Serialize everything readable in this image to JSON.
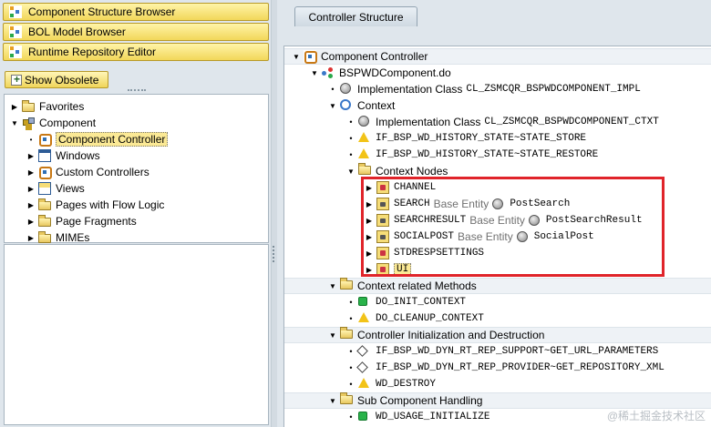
{
  "left_panel": {
    "browsers": [
      {
        "label": "Component Structure Browser",
        "icon": "structure-icon"
      },
      {
        "label": "BOL Model Browser",
        "icon": "structure-icon"
      },
      {
        "label": "Runtime Repository Editor",
        "icon": "structure-icon"
      }
    ],
    "show_obsolete_label": "Show Obsolete",
    "tree": [
      {
        "label": "Favorites",
        "icon": "folder-icon",
        "expander": "collapsed",
        "selected": false
      },
      {
        "label": "Component",
        "icon": "component-icon",
        "expander": "expanded",
        "selected": false
      },
      {
        "label": "Component Controller",
        "icon": "controller-icon",
        "expander": "none",
        "selected": true
      },
      {
        "label": "Windows",
        "icon": "window-icon",
        "expander": "collapsed",
        "selected": false
      },
      {
        "label": "Custom Controllers",
        "icon": "controller-icon",
        "expander": "collapsed",
        "selected": false
      },
      {
        "label": "Views",
        "icon": "view-icon",
        "expander": "collapsed",
        "selected": false
      },
      {
        "label": "Pages with Flow Logic",
        "icon": "folder-icon",
        "expander": "collapsed",
        "selected": false
      },
      {
        "label": "Page Fragments",
        "icon": "folder-icon",
        "expander": "collapsed",
        "selected": false
      },
      {
        "label": "MIMEs",
        "icon": "folder-icon",
        "expander": "collapsed",
        "selected": false
      }
    ]
  },
  "right_panel": {
    "tab_label": "Controller Structure",
    "rows": [
      {
        "text": "Component Controller",
        "extra": "",
        "ref": "",
        "icon": "component-controller-icon",
        "expander": "expanded",
        "mono": false,
        "header": true,
        "selected": false
      },
      {
        "text": "BSPWDComponent.do",
        "extra": "",
        "ref": "",
        "icon": "bsp-component-icon",
        "expander": "expanded",
        "mono": false,
        "header": false,
        "selected": false
      },
      {
        "text": "Implementation Class",
        "extra": "",
        "ref": "CL_ZSMCQR_BSPWDCOMPONENT_IMPL",
        "icon": "class-icon",
        "expander": "bullet",
        "mono": false,
        "header": false,
        "selected": false
      },
      {
        "text": "Context",
        "extra": "",
        "ref": "",
        "icon": "context-icon",
        "expander": "expanded",
        "mono": false,
        "header": false,
        "selected": false
      },
      {
        "text": "Implementation Class",
        "extra": "",
        "ref": "CL_ZSMCQR_BSPWDCOMPONENT_CTXT",
        "icon": "class-icon",
        "expander": "bullet",
        "mono": false,
        "header": false,
        "selected": false
      },
      {
        "text": "IF_BSP_WD_HISTORY_STATE~STATE_STORE",
        "extra": "",
        "ref": "",
        "icon": "warning-icon",
        "expander": "bullet",
        "mono": true,
        "header": false,
        "selected": false
      },
      {
        "text": "IF_BSP_WD_HISTORY_STATE~STATE_RESTORE",
        "extra": "",
        "ref": "",
        "icon": "warning-icon",
        "expander": "bullet",
        "mono": true,
        "header": false,
        "selected": false
      },
      {
        "text": "Context Nodes",
        "extra": "",
        "ref": "",
        "icon": "folder-icon",
        "expander": "expanded",
        "mono": false,
        "header": false,
        "selected": false
      },
      {
        "text": "CHANNEL",
        "extra": "",
        "ref": "",
        "icon": "context-node-icon",
        "expander": "collapsed",
        "mono": true,
        "header": false,
        "selected": false
      },
      {
        "text": "SEARCH",
        "extra": "Base Entity",
        "ref": "PostSearch",
        "icon": "locked-node-icon",
        "expander": "collapsed",
        "mono": true,
        "header": false,
        "selected": false
      },
      {
        "text": "SEARCHRESULT",
        "extra": "Base Entity",
        "ref": "PostSearchResult",
        "icon": "locked-node-icon",
        "expander": "collapsed",
        "mono": true,
        "header": false,
        "selected": false
      },
      {
        "text": "SOCIALPOST",
        "extra": "Base Entity",
        "ref": "SocialPost",
        "icon": "locked-node-icon",
        "expander": "collapsed",
        "mono": true,
        "header": false,
        "selected": false
      },
      {
        "text": "STDRESPSETTINGS",
        "extra": "",
        "ref": "",
        "icon": "context-node-icon",
        "expander": "collapsed",
        "mono": true,
        "header": false,
        "selected": false
      },
      {
        "text": "UI",
        "extra": "",
        "ref": "",
        "icon": "context-node-icon",
        "expander": "collapsed",
        "mono": true,
        "header": false,
        "selected": true
      },
      {
        "text": "Context related Methods",
        "extra": "",
        "ref": "",
        "icon": "folder-icon",
        "expander": "expanded",
        "mono": false,
        "header": true,
        "selected": false
      },
      {
        "text": "DO_INIT_CONTEXT",
        "extra": "",
        "ref": "",
        "icon": "implemented-icon",
        "expander": "bullet",
        "mono": true,
        "header": false,
        "selected": false
      },
      {
        "text": "DO_CLEANUP_CONTEXT",
        "extra": "",
        "ref": "",
        "icon": "warning-icon",
        "expander": "bullet",
        "mono": true,
        "header": false,
        "selected": false
      },
      {
        "text": "Controller Initialization and Destruction",
        "extra": "",
        "ref": "",
        "icon": "folder-icon",
        "expander": "expanded",
        "mono": false,
        "header": true,
        "selected": false
      },
      {
        "text": "IF_BSP_WD_DYN_RT_REP_SUPPORT~GET_URL_PARAMETERS",
        "extra": "",
        "ref": "",
        "icon": "method-icon",
        "expander": "bullet",
        "mono": true,
        "header": false,
        "selected": false
      },
      {
        "text": "IF_BSP_WD_DYN_RT_REP_PROVIDER~GET_REPOSITORY_XML",
        "extra": "",
        "ref": "",
        "icon": "method-icon",
        "expander": "bullet",
        "mono": true,
        "header": false,
        "selected": false
      },
      {
        "text": "WD_DESTROY",
        "extra": "",
        "ref": "",
        "icon": "warning-icon",
        "expander": "bullet",
        "mono": true,
        "header": false,
        "selected": false
      },
      {
        "text": "Sub Component Handling",
        "extra": "",
        "ref": "",
        "icon": "folder-icon",
        "expander": "expanded",
        "mono": false,
        "header": true,
        "selected": false
      },
      {
        "text": "WD_USAGE_INITIALIZE",
        "extra": "",
        "ref": "",
        "icon": "implemented-icon",
        "expander": "bullet",
        "mono": true,
        "header": false,
        "selected": false
      }
    ]
  },
  "watermark": "@稀土掘金技术社区",
  "colors": {
    "highlight": "#e0242a",
    "selection": "#fbe995",
    "background": "#dfe6ec"
  }
}
